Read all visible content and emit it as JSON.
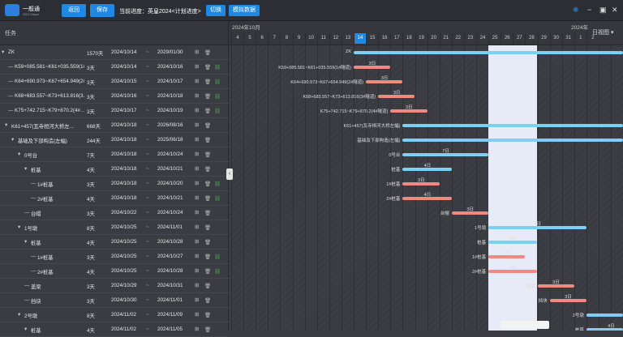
{
  "app": {
    "name": "一般通",
    "subtitle": "XXX Cloud"
  },
  "toolbar": {
    "back": "返回",
    "save": "保存",
    "progress_label": "当前进度：英皇2024<计划进度>",
    "switch": "切换",
    "simulate": "模拟数据"
  },
  "grid": {
    "header_task": "任务"
  },
  "timeline": {
    "month1": "2024年10月",
    "month2": "2024年",
    "view": "日视图",
    "days": [
      "4",
      "5",
      "6",
      "7",
      "8",
      "9",
      "10",
      "11",
      "12",
      "13",
      "14",
      "15",
      "16",
      "17",
      "18",
      "19",
      "20",
      "21",
      "22",
      "23",
      "24",
      "25",
      "26",
      "27",
      "28",
      "29",
      "30",
      "31",
      "1",
      "2"
    ]
  },
  "rows": [
    {
      "name": "ZK",
      "dur": "1570天",
      "start": "2024/10/14",
      "end": "2029/01/30",
      "lock": false,
      "bar_label": "ZK",
      "dlabel": ""
    },
    {
      "name": "K59+085.581~K61+035.559(1#…",
      "dur": "3天",
      "start": "2024/10/14",
      "end": "2024/10/16",
      "lock": true,
      "bar_label": "K59+085.581~K61+035.559(1#隧道)",
      "dlabel": "3日"
    },
    {
      "name": "K64+690.973~K67+654.949(2#…",
      "dur": "3天",
      "start": "2024/10/15",
      "end": "2024/10/17",
      "lock": true,
      "bar_label": "K64+690.973~K67+654.949(2#隧道)",
      "dlabel": "3日"
    },
    {
      "name": "K68+683.557~K73+613.816(3…",
      "dur": "3天",
      "start": "2024/10/16",
      "end": "2024/10/18",
      "lock": true,
      "bar_label": "K68+683.557~K73+613.816(3#隧道)",
      "dlabel": "3日"
    },
    {
      "name": "K75+742.715~K79+870.2(4#…",
      "dur": "3天",
      "start": "2024/10/17",
      "end": "2024/10/19",
      "lock": true,
      "bar_label": "K75+742.715~K79+870.2(4#隧道)",
      "dlabel": "3日"
    },
    {
      "name": "K61+457(瓦寺桓河大桥左…",
      "dur": "668天",
      "start": "2024/10/18",
      "end": "2026/08/16",
      "lock": false,
      "bar_label": "K61+457(瓦寺桓河大桥左幅)",
      "dlabel": ""
    },
    {
      "name": "基础及下部构造(左幅)",
      "dur": "244天",
      "start": "2024/10/18",
      "end": "2025/06/18",
      "lock": false,
      "bar_label": "基础及下部构造(左幅)",
      "dlabel": ""
    },
    {
      "name": "0号台",
      "dur": "7天",
      "start": "2024/10/18",
      "end": "2024/10/24",
      "lock": false,
      "bar_label": "0号台",
      "dlabel": "7日"
    },
    {
      "name": "桩基",
      "dur": "4天",
      "start": "2024/10/18",
      "end": "2024/10/21",
      "lock": false,
      "bar_label": "桩基",
      "dlabel": "4日"
    },
    {
      "name": "1#桩基",
      "dur": "3天",
      "start": "2024/10/18",
      "end": "2024/10/20",
      "lock": true,
      "bar_label": "1#桩基",
      "dlabel": "3日"
    },
    {
      "name": "2#桩基",
      "dur": "4天",
      "start": "2024/10/18",
      "end": "2024/10/21",
      "lock": true,
      "bar_label": "2#桩基",
      "dlabel": "4日"
    },
    {
      "name": "台帽",
      "dur": "3天",
      "start": "2024/10/22",
      "end": "2024/10/24",
      "lock": false,
      "bar_label": "台帽",
      "dlabel": "3日"
    },
    {
      "name": "1号墩",
      "dur": "8天",
      "start": "2024/10/25",
      "end": "2024/11/01",
      "lock": false,
      "bar_label": "1号墩",
      "dlabel": "8日"
    },
    {
      "name": "桩基",
      "dur": "4天",
      "start": "2024/10/25",
      "end": "2024/10/28",
      "lock": false,
      "bar_label": "桩基",
      "dlabel": "4日"
    },
    {
      "name": "1#桩基",
      "dur": "3天",
      "start": "2024/10/25",
      "end": "2024/10/27",
      "lock": true,
      "bar_label": "1#桩基",
      "dlabel": "3日"
    },
    {
      "name": "2#桩基",
      "dur": "4天",
      "start": "2024/10/25",
      "end": "2024/10/28",
      "lock": true,
      "bar_label": "2#桩基",
      "dlabel": "4日"
    },
    {
      "name": "盖梁",
      "dur": "3天",
      "start": "2024/10/29",
      "end": "2024/10/31",
      "lock": false,
      "bar_label": "盖梁",
      "dlabel": "3日"
    },
    {
      "name": "挡块",
      "dur": "3天",
      "start": "2024/10/30",
      "end": "2024/11/01",
      "lock": false,
      "bar_label": "挡块",
      "dlabel": "3日"
    },
    {
      "name": "2号墩",
      "dur": "8天",
      "start": "2024/11/02",
      "end": "2024/11/09",
      "lock": false,
      "bar_label": "2号墩",
      "dlabel": ""
    },
    {
      "name": "桩基",
      "dur": "4天",
      "start": "2024/11/02",
      "end": "2024/11/05",
      "lock": false,
      "bar_label": "桩基",
      "dlabel": "4日"
    }
  ],
  "colors": {
    "blue": "#7ecff4",
    "red": "#ef8a80",
    "accent": "#1e88e5",
    "lock": "#4caf50"
  }
}
